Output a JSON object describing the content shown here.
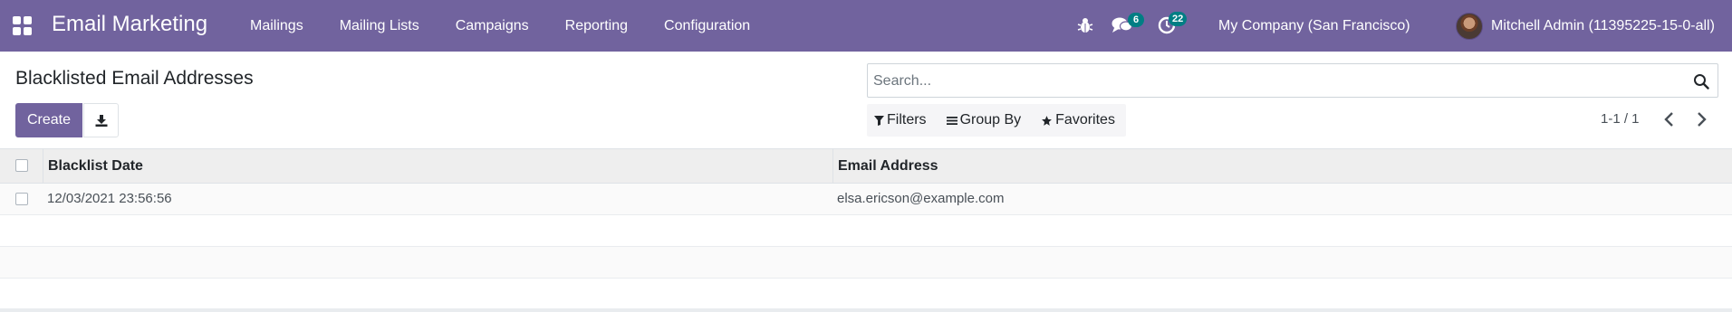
{
  "navbar": {
    "brand": "Email Marketing",
    "menu": [
      "Mailings",
      "Mailing Lists",
      "Campaigns",
      "Reporting",
      "Configuration"
    ],
    "messages_badge": "6",
    "activities_badge": "22",
    "company": "My Company (San Francisco)",
    "user": "Mitchell Admin (11395225-15-0-all)"
  },
  "control_panel": {
    "title": "Blacklisted Email Addresses",
    "create_label": "Create",
    "search_placeholder": "Search...",
    "filters_label": "Filters",
    "group_by_label": "Group By",
    "favorites_label": "Favorites",
    "pager": "1-1 / 1"
  },
  "table": {
    "columns": [
      "Blacklist Date",
      "Email Address"
    ],
    "rows": [
      {
        "date": "12/03/2021 23:56:56",
        "email": "elsa.ericson@example.com"
      }
    ]
  },
  "colors": {
    "navbar": "#71639e",
    "badge": "#017e84",
    "primary_button": "#71639e"
  }
}
